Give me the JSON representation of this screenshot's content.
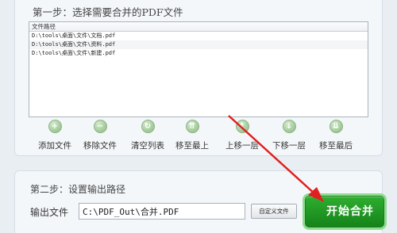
{
  "step1": {
    "title": "第一步：选择需要合并的PDF文件",
    "list_header": "文件路径",
    "files": [
      "D:\\tools\\桌面\\文件\\文档.pdf",
      "D:\\tools\\桌面\\文件\\资料.pdf",
      "D:\\tools\\桌面\\文件\\新建.pdf"
    ],
    "toolbar": [
      {
        "label": "添加文件",
        "icon": "plus-icon",
        "glyph": "+"
      },
      {
        "label": "移除文件",
        "icon": "minus-icon",
        "glyph": "−"
      },
      {
        "label": "清空列表",
        "icon": "refresh-icon",
        "glyph": "↻"
      },
      {
        "label": "移至最上",
        "icon": "move-top-icon",
        "glyph": "⇈"
      },
      {
        "label": "上移一层",
        "icon": "arrow-up-icon",
        "glyph": "↑"
      },
      {
        "label": "下移一层",
        "icon": "arrow-down-icon",
        "glyph": "↓"
      },
      {
        "label": "移至最后",
        "icon": "move-bottom-icon",
        "glyph": "⇊"
      }
    ]
  },
  "step2": {
    "title": "第二步：设置输出路径",
    "output_label": "输出文件",
    "output_value": "C:\\PDF_Out\\合并.PDF",
    "custom_button": "自定义文件",
    "start_button": "开始合并"
  },
  "colors": {
    "accent_green": "#1e9a22",
    "annotation_red": "#e02020"
  }
}
